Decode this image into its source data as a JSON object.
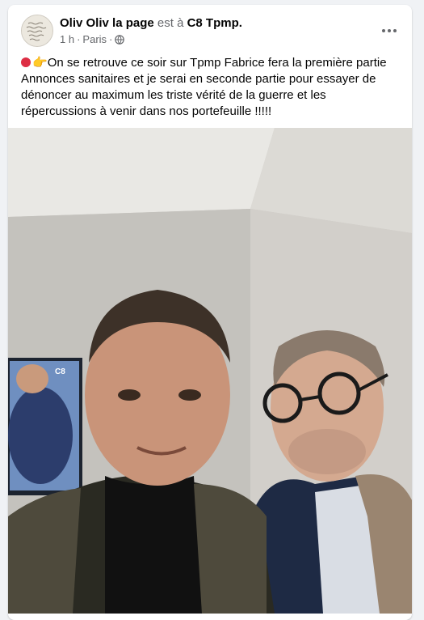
{
  "post": {
    "author_name": "Oliv Oliv la page",
    "relation_text": "est à",
    "page_name": "C8 Tpmp.",
    "time": "1 h",
    "separator": "·",
    "location": "Paris",
    "visibility_icon": "globe-icon",
    "more_icon": "more-options-icon",
    "text_emoji_1": "red-circle-icon",
    "text_emoji_2": "👉",
    "text": "On se retrouve ce soir sur Tpmp Fabrice fera la première partie Annonces sanitaires et je serai en seconde partie pour essayer de dénoncer au maximum les triste vérité de la guerre et les répercussions à venir dans nos portefeuille !!!!!",
    "photo_overlay_text": "C8"
  },
  "colors": {
    "background": "#f0f2f5",
    "card": "#ffffff",
    "primary_text": "#050505",
    "secondary_text": "#65676b",
    "red_dot": "#dd2e44"
  }
}
